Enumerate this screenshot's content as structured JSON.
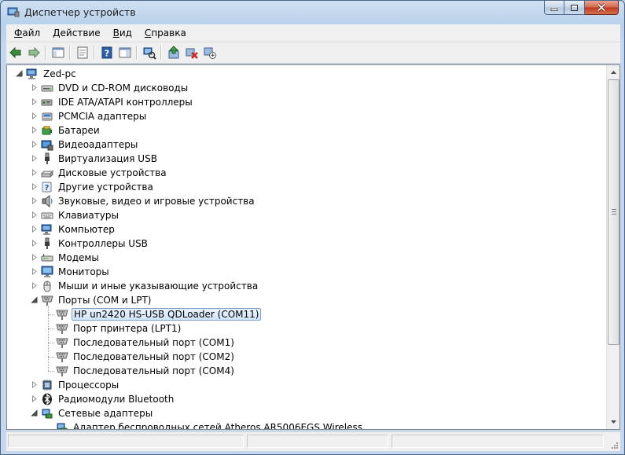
{
  "window": {
    "title": "Диспетчер устройств"
  },
  "menu": [
    "Файл",
    "Действие",
    "Вид",
    "Справка"
  ],
  "toolbar": [
    "back-icon",
    "forward-icon",
    "sep",
    "show-hide-console-tree-icon",
    "sep",
    "properties-icon",
    "sep",
    "help-icon",
    "action-pane-icon",
    "sep",
    "scan-hardware-icon",
    "sep",
    "update-driver-icon",
    "uninstall-icon",
    "disable-icon"
  ],
  "tree": {
    "root": "Zed-pc",
    "items": [
      {
        "label": "DVD и CD-ROM дисководы",
        "icon": "dvd-drive-icon",
        "state": "collapsed",
        "level": 1
      },
      {
        "label": "IDE ATA/ATAPI контроллеры",
        "icon": "ide-controller-icon",
        "state": "collapsed",
        "level": 1
      },
      {
        "label": "PCMCIA адаптеры",
        "icon": "pcmcia-icon",
        "state": "collapsed",
        "level": 1
      },
      {
        "label": "Батареи",
        "icon": "battery-icon",
        "state": "collapsed",
        "level": 1
      },
      {
        "label": "Видеоадаптеры",
        "icon": "display-adapter-icon",
        "state": "collapsed",
        "level": 1
      },
      {
        "label": "Виртуализация USB",
        "icon": "usb-plug-icon",
        "state": "collapsed",
        "level": 1
      },
      {
        "label": "Дисковые устройства",
        "icon": "disk-drive-icon",
        "state": "collapsed",
        "level": 1
      },
      {
        "label": "Другие устройства",
        "icon": "unknown-device-icon",
        "state": "collapsed",
        "level": 1
      },
      {
        "label": "Звуковые, видео и игровые устройства",
        "icon": "speaker-icon",
        "state": "collapsed",
        "level": 1
      },
      {
        "label": "Клавиатуры",
        "icon": "keyboard-icon",
        "state": "collapsed",
        "level": 1
      },
      {
        "label": "Компьютер",
        "icon": "computer-icon",
        "state": "collapsed",
        "level": 1
      },
      {
        "label": "Контроллеры USB",
        "icon": "usb-plug-icon",
        "state": "collapsed",
        "level": 1
      },
      {
        "label": "Модемы",
        "icon": "modem-icon",
        "state": "collapsed",
        "level": 1
      },
      {
        "label": "Мониторы",
        "icon": "monitor-icon",
        "state": "collapsed",
        "level": 1
      },
      {
        "label": "Мыши и иные указывающие устройства",
        "icon": "mouse-icon",
        "state": "collapsed",
        "level": 1
      },
      {
        "label": "Порты (COM и LPT)",
        "icon": "port-icon",
        "state": "expanded",
        "level": 1
      },
      {
        "label": "HP un2420 HS-USB QDLoader (COM11)",
        "icon": "port-icon",
        "state": "leaf",
        "level": 2,
        "selected": true
      },
      {
        "label": "Порт принтера (LPT1)",
        "icon": "port-icon",
        "state": "leaf",
        "level": 2
      },
      {
        "label": "Последовательный порт (COM1)",
        "icon": "port-icon",
        "state": "leaf",
        "level": 2
      },
      {
        "label": "Последовательный порт (COM2)",
        "icon": "port-icon",
        "state": "leaf",
        "level": 2
      },
      {
        "label": "Последовательный порт (COM4)",
        "icon": "port-icon",
        "state": "leaf",
        "level": 2
      },
      {
        "label": "Процессоры",
        "icon": "processor-icon",
        "state": "collapsed",
        "level": 1
      },
      {
        "label": "Радиомодули Bluetooth",
        "icon": "bluetooth-icon",
        "state": "collapsed",
        "level": 1
      },
      {
        "label": "Сетевые адаптеры",
        "icon": "network-adapter-icon",
        "state": "expanded",
        "level": 1
      },
      {
        "label": "Адаптер беспроводных сетей Atheros AR5006EGS Wireless",
        "icon": "network-adapter-icon",
        "state": "leaf",
        "level": 2
      }
    ]
  },
  "colors": {
    "selection_border": "#7da2ce",
    "selection_fill": "#d3e5fb",
    "frame": "#bcd3ec"
  }
}
